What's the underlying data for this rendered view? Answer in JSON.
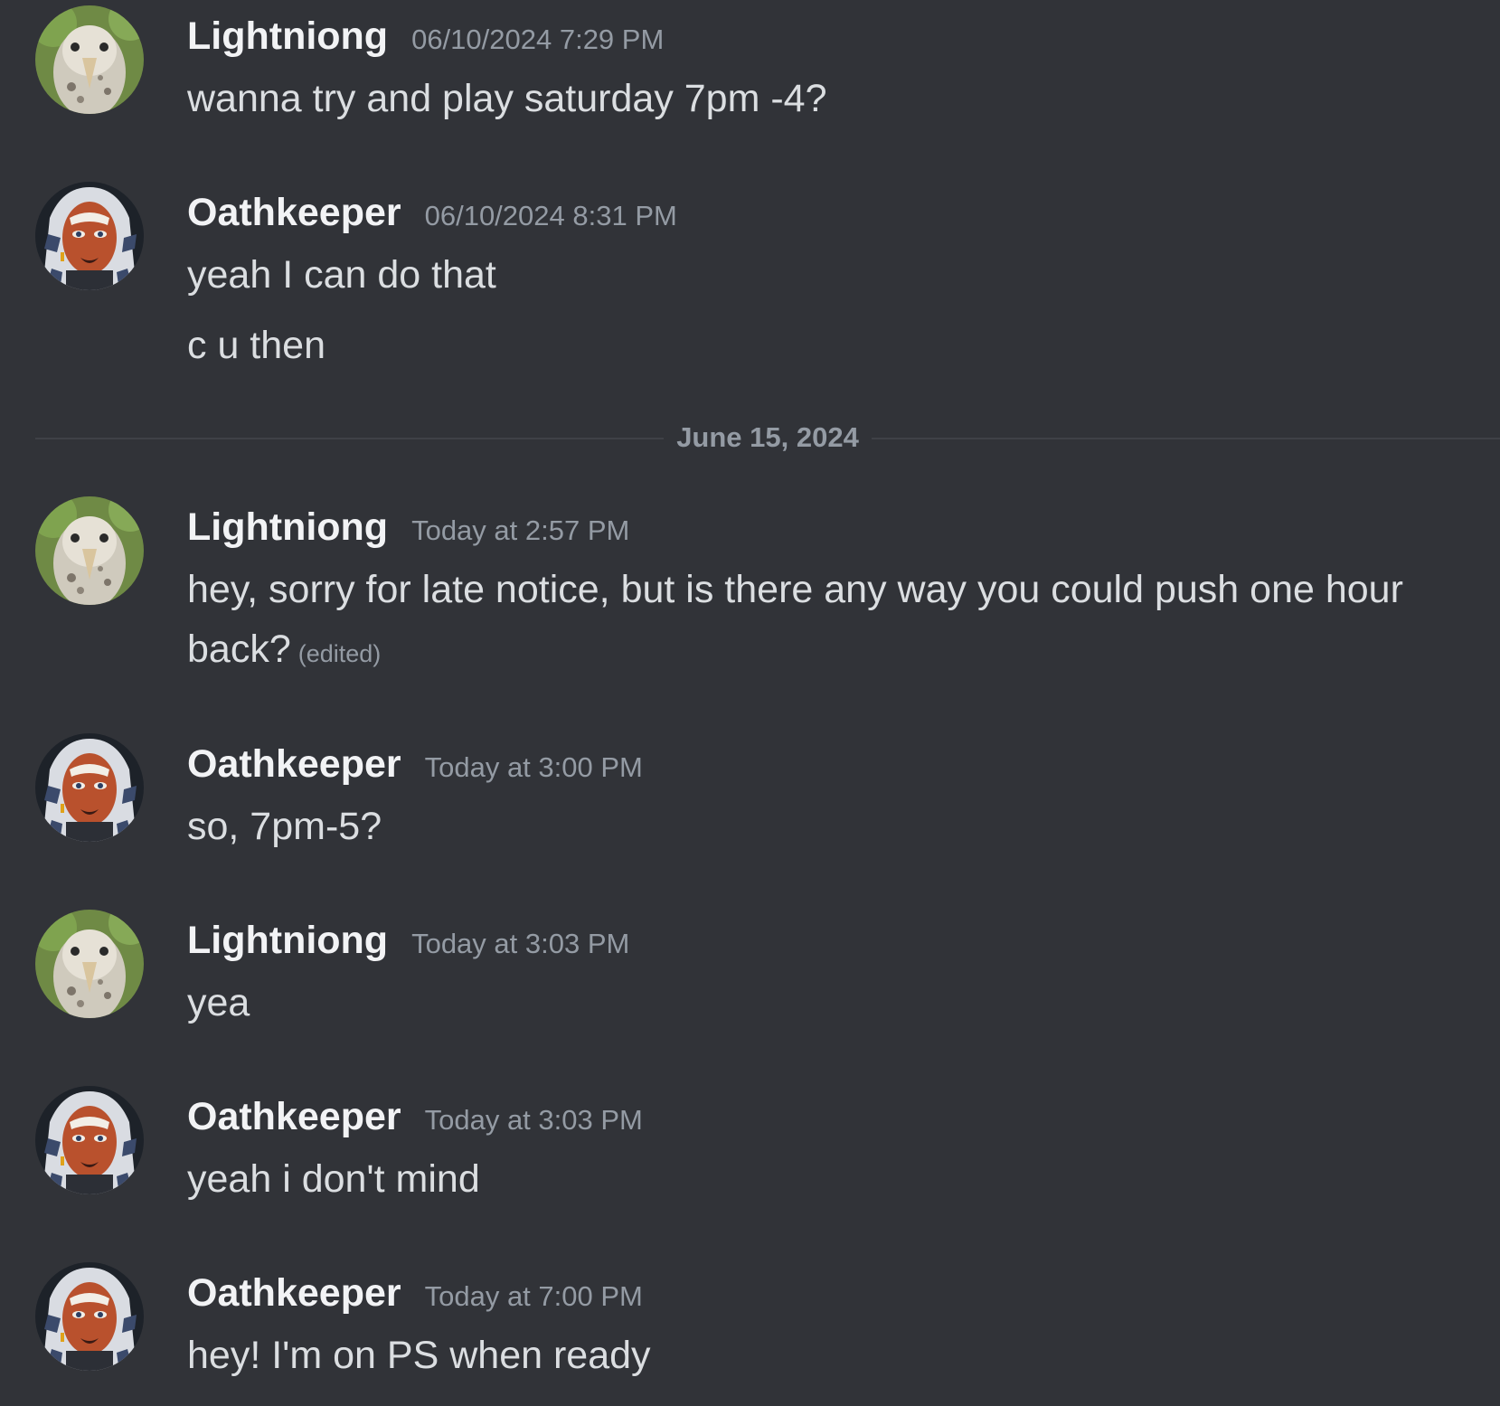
{
  "messages": [
    {
      "author": "Lightniong",
      "timestamp": "06/10/2024 7:29 PM",
      "lines": [
        "wanna try and play saturday 7pm -4?"
      ]
    },
    {
      "author": "Oathkeeper",
      "timestamp": "06/10/2024 8:31 PM",
      "lines": [
        "yeah I can do that",
        "c u then"
      ]
    },
    {
      "author": "Lightniong",
      "timestamp": "Today at 2:57 PM",
      "lines": [
        "hey, sorry for late notice, but is there any way you could push one hour",
        "back?"
      ],
      "edited": "(edited)"
    },
    {
      "author": "Oathkeeper",
      "timestamp": "Today at 3:00 PM",
      "lines": [
        "so, 7pm-5?"
      ]
    },
    {
      "author": "Lightniong",
      "timestamp": "Today at 3:03 PM",
      "lines": [
        "yea"
      ]
    },
    {
      "author": "Oathkeeper",
      "timestamp": "Today at 3:03 PM",
      "lines": [
        "yeah i don't mind"
      ]
    },
    {
      "author": "Oathkeeper",
      "timestamp": "Today at 7:00 PM",
      "lines": [
        "hey! I'm on PS when ready"
      ]
    }
  ],
  "date_divider": "June 15, 2024"
}
